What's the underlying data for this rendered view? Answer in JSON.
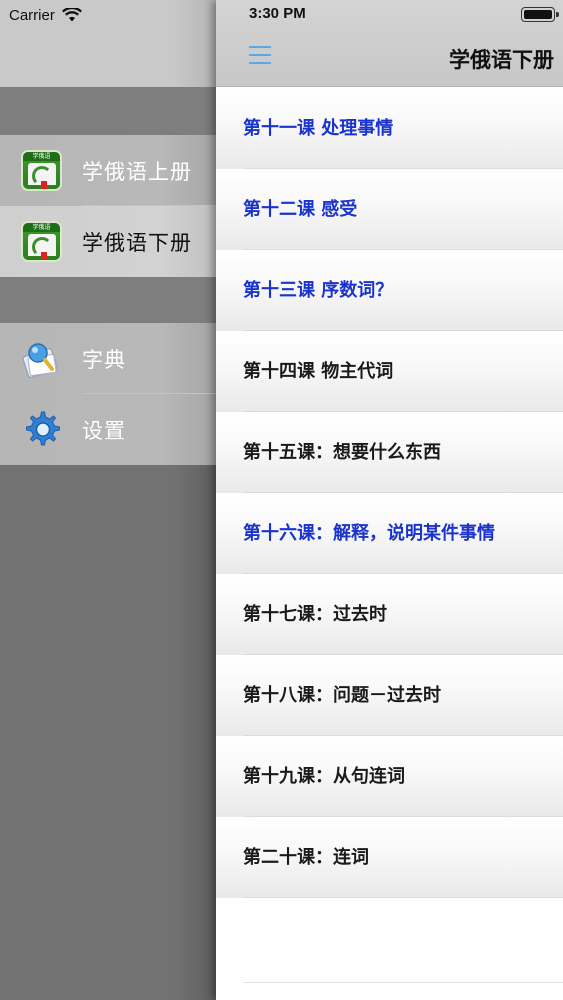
{
  "status_bar": {
    "carrier": "Carrier",
    "time": "3:30 PM"
  },
  "drawer": {
    "items": [
      {
        "label": "学俄语上册",
        "icon": "book-app-icon",
        "selected": false
      },
      {
        "label": "学俄语下册",
        "icon": "book-app-icon",
        "selected": true
      },
      {
        "label": "字典",
        "icon": "dictionary-icon",
        "selected": false
      },
      {
        "label": "设置",
        "icon": "gear-icon",
        "selected": false
      }
    ]
  },
  "navbar": {
    "title": "学俄语下册",
    "menu_icon": "hamburger-menu-icon"
  },
  "lessons": [
    {
      "title": "第十一课 处理事情",
      "highlighted": true
    },
    {
      "title": "第十二课 感受",
      "highlighted": true
    },
    {
      "title": "第十三课 序数词？",
      "highlighted": true
    },
    {
      "title": "第十四课 物主代词",
      "highlighted": false
    },
    {
      "title": "第十五课：想要什么东西",
      "highlighted": false
    },
    {
      "title": "第十六课：解释，说明某件事情",
      "highlighted": true
    },
    {
      "title": "第十七课：过去时",
      "highlighted": false
    },
    {
      "title": "第十八课：问题－过去时",
      "highlighted": false
    },
    {
      "title": "第十九课：从句连词",
      "highlighted": false
    },
    {
      "title": "第二十课：连词",
      "highlighted": false
    }
  ],
  "colors": {
    "accent_blue": "#1a33cc",
    "menu_icon_blue": "#5aa8e8",
    "drawer_gray": "#727272"
  }
}
